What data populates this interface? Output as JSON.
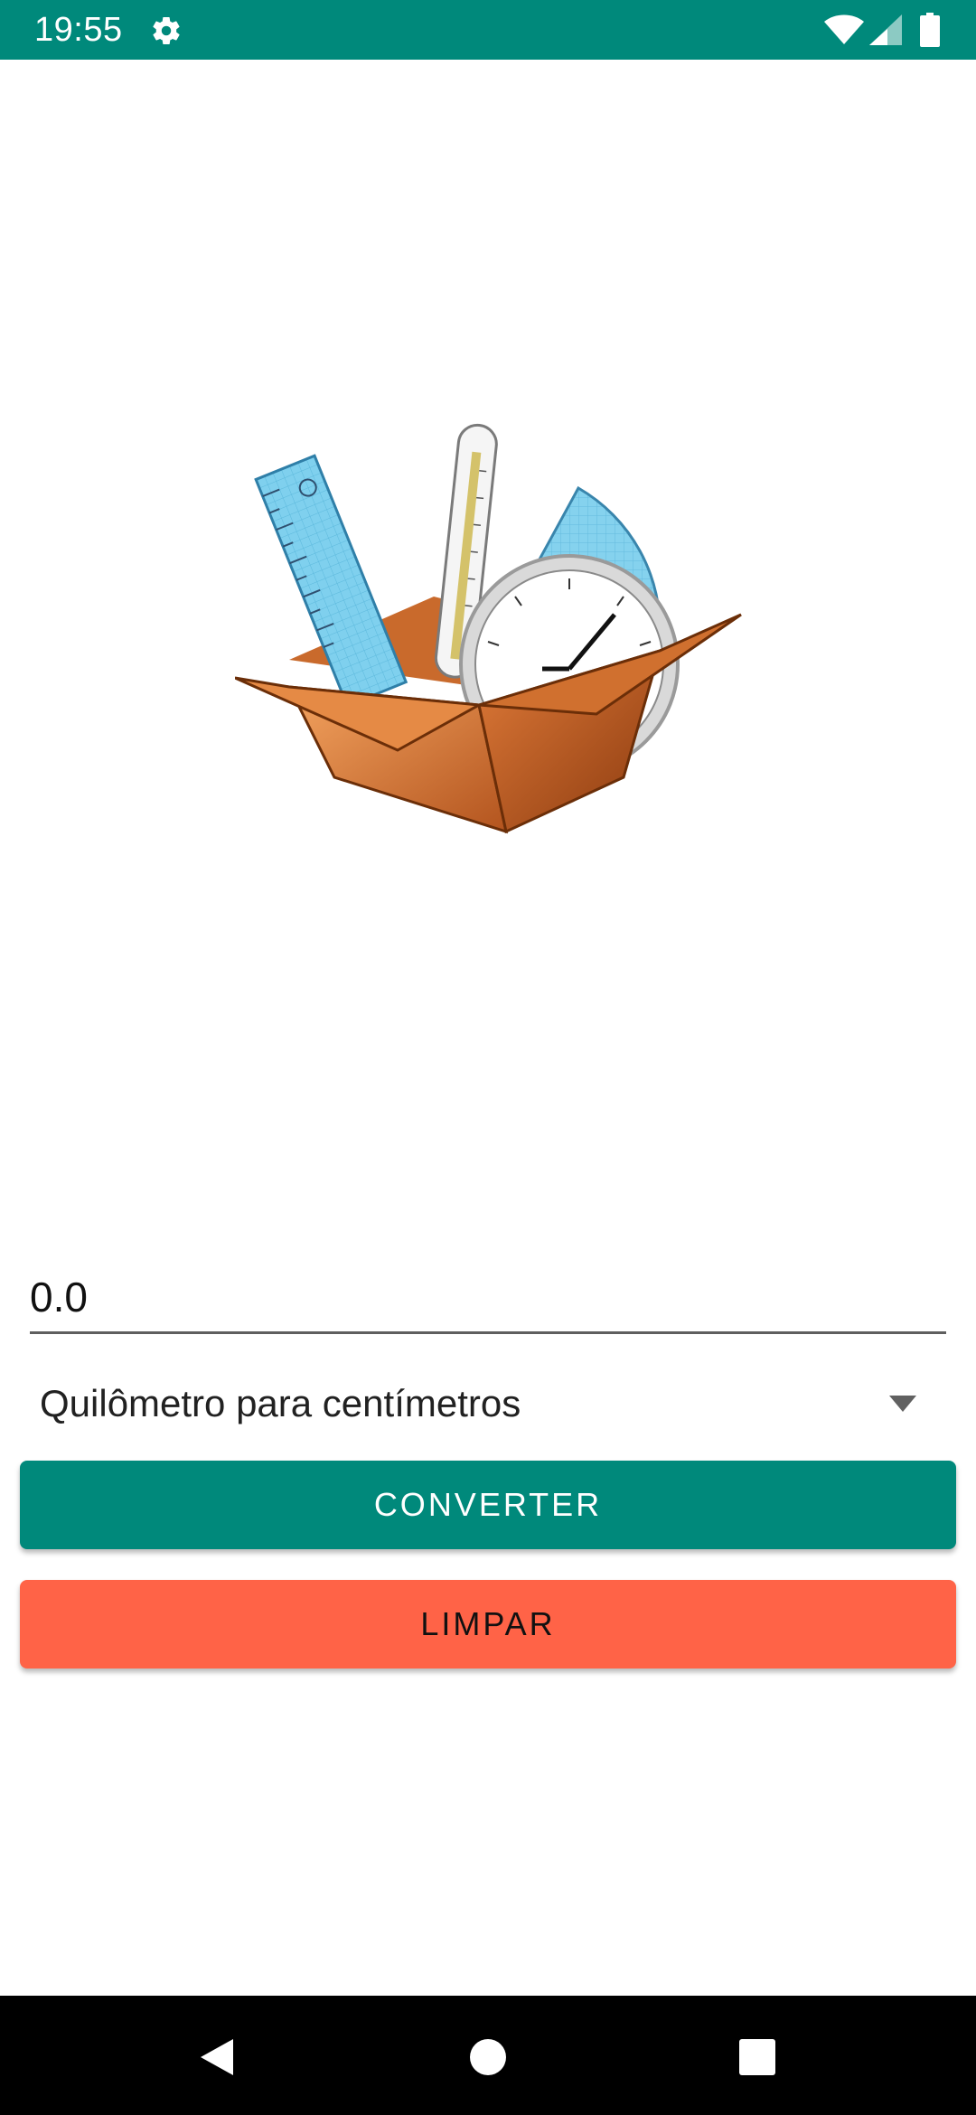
{
  "status_bar": {
    "time": "19:55",
    "icons": [
      "gear-icon",
      "wifi-icon",
      "signal-icon",
      "battery-icon"
    ],
    "background": "#00897b"
  },
  "illustration": {
    "icon": "measurement-tools-box-illustration"
  },
  "input": {
    "value": "0.0"
  },
  "spinner": {
    "selected": "Quilômetro para centímetros"
  },
  "buttons": {
    "convert_label": "CONVERTER",
    "clear_label": "LIMPAR",
    "convert_color": "#00897b",
    "clear_color": "#ff6347"
  },
  "nav_bar": {
    "icons": [
      "back-icon",
      "home-icon",
      "recent-apps-icon"
    ]
  }
}
